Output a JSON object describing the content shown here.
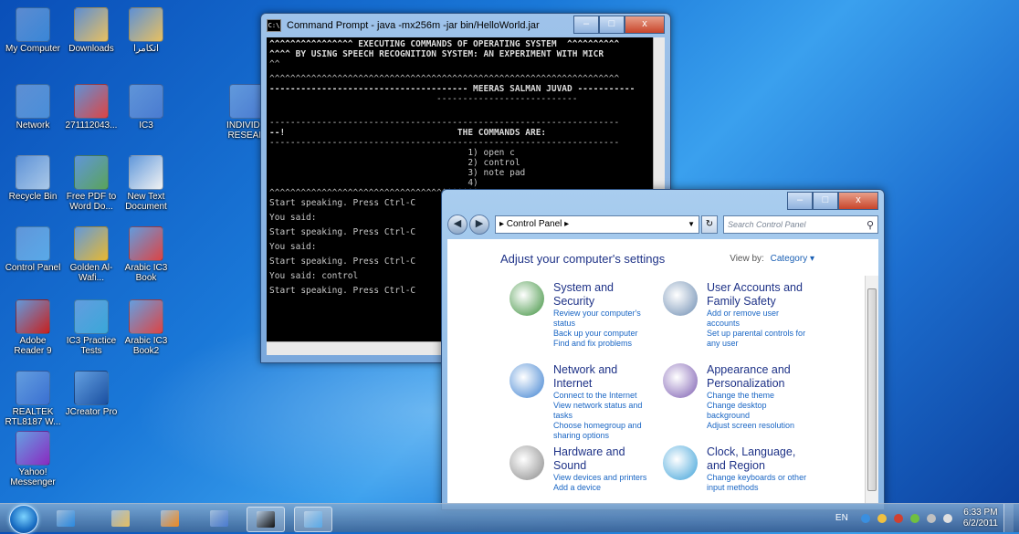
{
  "desktop_icons": [
    {
      "id": "my-computer",
      "label": "My Computer",
      "icon": "computer-icon",
      "color": "#3a86d6"
    },
    {
      "id": "downloads",
      "label": "Downloads",
      "icon": "folder-icon",
      "color": "#e8c060"
    },
    {
      "id": "arabic-folder",
      "label": "اتكامرا",
      "icon": "folder-icon",
      "color": "#e8c060"
    },
    {
      "id": "network",
      "label": "Network",
      "icon": "network-icon",
      "color": "#4a8ed8"
    },
    {
      "id": "pdf-271112043",
      "label": "271112043...",
      "icon": "pdf-document-icon",
      "color": "#d44"
    },
    {
      "id": "ic3",
      "label": "IC3",
      "icon": "word-document-icon",
      "color": "#4a7bd0"
    },
    {
      "id": "individual-research",
      "label": "INDIVIDU RESEAR",
      "icon": "word-document-icon",
      "color": "#4a7bd0"
    },
    {
      "id": "recycle-bin",
      "label": "Recycle Bin",
      "icon": "recycle-bin-icon",
      "color": "#aac8e8"
    },
    {
      "id": "free-pdf-to-word",
      "label": "Free PDF to Word Do...",
      "icon": "pdf-converter-icon",
      "color": "#5aa35a"
    },
    {
      "id": "new-text-document",
      "label": "New Text Document",
      "icon": "text-document-icon",
      "color": "#f2f2f2"
    },
    {
      "id": "control-panel",
      "label": "Control Panel",
      "icon": "control-panel-icon",
      "color": "#59a9e8"
    },
    {
      "id": "golden-al-wafi",
      "label": "Golden Al-Wafi...",
      "icon": "golden-app-icon",
      "color": "#e8b830"
    },
    {
      "id": "arabic-ic3-book",
      "label": "Arabic IC3 Book",
      "icon": "pdf-document-icon",
      "color": "#d44"
    },
    {
      "id": "adobe-reader",
      "label": "Adobe Reader 9",
      "icon": "adobe-reader-icon",
      "color": "#c8201e"
    },
    {
      "id": "ic3-practice-tests",
      "label": "IC3 Practice Tests",
      "icon": "practice-tests-icon",
      "color": "#3aa7d8"
    },
    {
      "id": "arabic-ic3-book-2",
      "label": "Arabic IC3 Book2",
      "icon": "pdf-document-icon",
      "color": "#d44"
    },
    {
      "id": "realtek",
      "label": "REALTEK RTL8187 W...",
      "icon": "wireless-utility-icon",
      "color": "#3a6fd0"
    },
    {
      "id": "jcreator-pro",
      "label": "JCreator Pro",
      "icon": "jcreator-icon",
      "color": "#1a4fa0"
    },
    {
      "id": "yahoo-messenger",
      "label": "Yahoo! Messenger",
      "icon": "yahoo-messenger-icon",
      "color": "#8a2ac0"
    }
  ],
  "cmd": {
    "title": "Command Prompt - java  -mx256m -jar bin/HelloWorld.jar",
    "lines": [
      "^^^^^^^^^^^^^^^^ EXECUTING COMMANDS OF OPERATING SYSTEM  ^^^^^^^^^^",
      "^^^^ BY USING SPEECH RECOGNITION SYSTEM: AN EXPERIMENT WITH MICR",
      "^^",
      "",
      "^^^^^^^^^^^^^^^^^^^^^^^^^^^^^^^^^^^^^^^^^^^^^^^^^^^^^^^^^^^^^^^^^^^",
      "-------------------------------------- MEERAS SALMAN JUVAD -----------",
      "                                ---------------------------",
      "",
      "",
      "",
      "-------------------------------------------------------------------",
      "--!                                 THE COMMANDS ARE:",
      "-------------------------------------------------------------------",
      "                                      1) open c",
      "                                      2) control",
      "                                      3) note pad",
      "                                      4)",
      "^^^^^^^^^^^^^^^^^^^^^^^^^^^^^^^^^^^^^^^^",
      "Start speaking. Press Ctrl-C",
      "",
      "You said:",
      "",
      "Start speaking. Press Ctrl-C",
      "",
      "You said:",
      "",
      "Start speaking. Press Ctrl-C",
      "",
      "You said: control",
      "",
      "Start speaking. Press Ctrl-C"
    ],
    "caption_buttons": {
      "minimize": "–",
      "maximize": "□",
      "close": "x"
    }
  },
  "control_panel": {
    "address": "▸ Control Panel ▸",
    "search_placeholder": "Search Control Panel",
    "heading": "Adjust your computer's settings",
    "view_by_label": "View by:",
    "view_by_value": "Category ▾",
    "categories": [
      {
        "title": "System and Security",
        "icon": "shield-checkmark-icon",
        "links": [
          "Review your computer's status",
          "Back up your computer",
          "Find and fix problems"
        ]
      },
      {
        "title": "User Accounts and Family Safety",
        "icon": "users-icon",
        "links": [
          "Add or remove user accounts",
          "Set up parental controls for any user"
        ]
      },
      {
        "title": "Network and Internet",
        "icon": "globe-network-icon",
        "links": [
          "Connect to the Internet",
          "View network status and tasks",
          "Choose homegroup and sharing options"
        ]
      },
      {
        "title": "Appearance and Personalization",
        "icon": "paint-monitor-icon",
        "links": [
          "Change the theme",
          "Change desktop background",
          "Adjust screen resolution"
        ]
      },
      {
        "title": "Hardware and Sound",
        "icon": "printer-icon",
        "links": [
          "View devices and printers",
          "Add a device"
        ]
      },
      {
        "title": "Clock, Language, and Region",
        "icon": "clock-globe-icon",
        "links": [
          "Change keyboards or other input methods"
        ]
      }
    ]
  },
  "taskbar": {
    "buttons": [
      {
        "id": "ie",
        "icon": "internet-explorer-icon",
        "color": "#2a8ae0"
      },
      {
        "id": "explorer",
        "icon": "folder-icon",
        "color": "#e8c060"
      },
      {
        "id": "media-player",
        "icon": "media-player-icon",
        "color": "#f08a20"
      },
      {
        "id": "word",
        "icon": "word-icon",
        "color": "#4a7bd0"
      },
      {
        "id": "cmd",
        "icon": "command-prompt-icon",
        "color": "#111"
      },
      {
        "id": "control-panel",
        "icon": "control-panel-icon",
        "color": "#59a9e8"
      }
    ],
    "language": "EN",
    "time": "6:33 PM",
    "date": "6/2/2011"
  }
}
